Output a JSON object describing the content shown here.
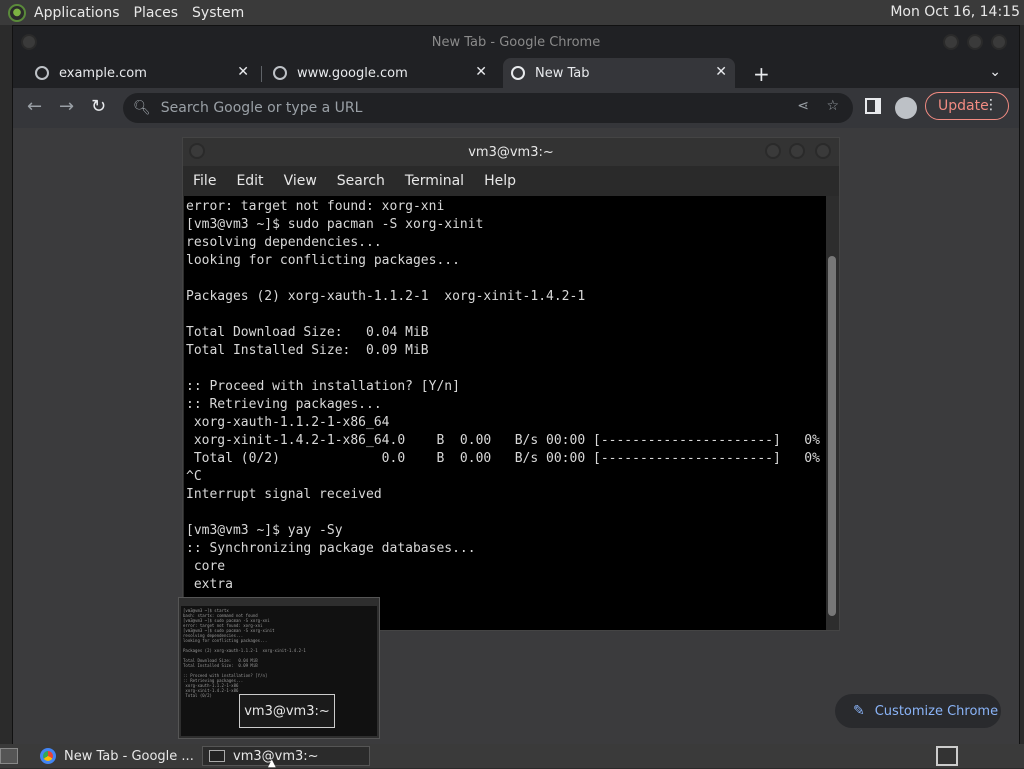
{
  "topbar": {
    "menus": [
      "Applications",
      "Places",
      "System"
    ],
    "clock": "Mon Oct 16, 14:15"
  },
  "chrome": {
    "window_title": "New Tab - Google Chrome",
    "tabs": [
      {
        "title": "example.com"
      },
      {
        "title": "www.google.com"
      },
      {
        "title": "New Tab"
      }
    ],
    "new_tab_label": "+",
    "omnibox_placeholder": "Search Google or type a URL",
    "update_label": "Update",
    "customize_label": "Customize Chrome"
  },
  "terminal": {
    "title": "vm3@vm3:~",
    "menu": [
      "File",
      "Edit",
      "View",
      "Search",
      "Terminal",
      "Help"
    ],
    "lines": [
      "error: target not found: xorg-xni",
      "[vm3@vm3 ~]$ sudo pacman -S xorg-xinit",
      "resolving dependencies...",
      "looking for conflicting packages...",
      "",
      "Packages (2) xorg-xauth-1.1.2-1  xorg-xinit-1.4.2-1",
      "",
      "Total Download Size:   0.04 MiB",
      "Total Installed Size:  0.09 MiB",
      "",
      ":: Proceed with installation? [Y/n]",
      ":: Retrieving packages...",
      " xorg-xauth-1.1.2-1-x86_64",
      " xorg-xinit-1.4.2-1-x86_64.0    B  0.00   B/s 00:00 [----------------------]   0%",
      " Total (0/2)             0.0    B  0.00   B/s 00:00 [----------------------]   0%",
      "^C",
      "Interrupt signal received",
      "",
      "[vm3@vm3 ~]$ yay -Sy",
      ":: Synchronizing package databases...",
      " core",
      " extra"
    ]
  },
  "preview": {
    "label": "vm3@vm3:~",
    "mini_text": "[vm3@vm3 ~]$ startx\nbash: startx: command not found\n[vm3@vm3 ~]$ sudo pacman -S xorg-xni\nerror: target not found: xorg-xni\n[vm3@vm3 ~]$ sudo pacman -S xorg-xinit\nresolving dependencies...\nlooking for conflicting packages...\n\nPackages (2) xorg-xauth-1.1.2-1  xorg-xinit-1.4.2-1\n\nTotal Download Size:   0.04 MiB\nTotal Installed Size:  0.09 MiB\n\n:: Proceed with installation? [Y/n]\n:: Retrieving packages...\n xorg-xauth-1.1.2-1-x86\n xorg-xinit-1.4.2-1-x86\n Total (0/2)"
  },
  "taskbar": {
    "items": [
      {
        "label": "New Tab - Google ..."
      },
      {
        "label": "vm3@vm3:~"
      }
    ]
  }
}
